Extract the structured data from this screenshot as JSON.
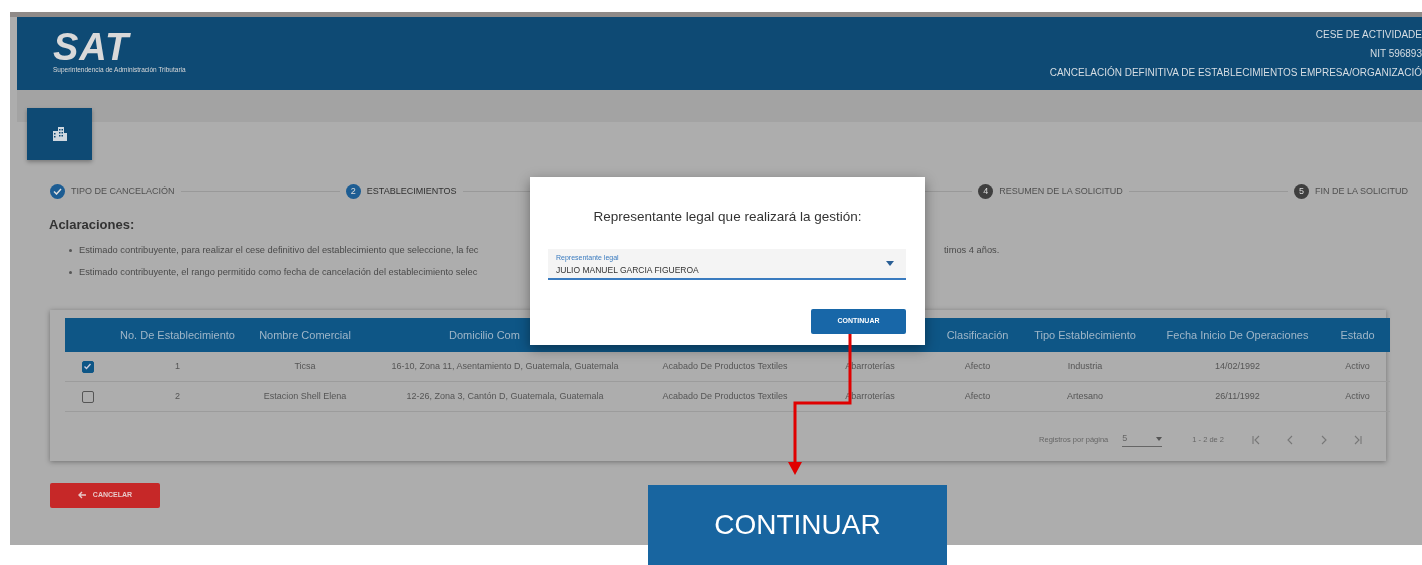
{
  "header": {
    "logo_text": "SAT",
    "logo_subtitle": "Superintendencia de Administración Tributaria",
    "lines": [
      "CESE DE ACTIVIDADE",
      "NIT 596893",
      "CANCELACIÓN DEFINITIVA DE ESTABLECIMIENTOS EMPRESA/ORGANIZACIÓ"
    ]
  },
  "stepper": [
    {
      "label": "TIPO DE CANCELACIÓN",
      "done": true,
      "active": false
    },
    {
      "number": "2",
      "label": "ESTABLECIMIENTOS",
      "done": false,
      "active": true
    },
    {
      "number": "4",
      "label": "RESUMEN DE LA SOLICITUD",
      "done": false,
      "active": false
    },
    {
      "number": "5",
      "label": "FIN DE LA SOLICITUD",
      "done": false,
      "active": false
    }
  ],
  "notes": {
    "title": "Aclaraciones:",
    "items": [
      {
        "text": "Estimado contribuyente, para realizar el cese definitivo del establecimiento que seleccione, la fec",
        "text_after": "timos 4 años."
      },
      {
        "text": "Estimado contribuyente, el rango permitido como fecha de cancelación del establecimiento selec"
      }
    ]
  },
  "table": {
    "columns": [
      {
        "label": "No. De Establecimiento"
      },
      {
        "label": "Nombre Comercial"
      },
      {
        "label": "Domicilio Com",
        "cut": true
      },
      {},
      {},
      {
        "label": "Clasificación"
      },
      {
        "label": "Tipo Establecimiento"
      },
      {
        "label": "Fecha Inicio De Operaciones"
      },
      {
        "label": "Estado"
      }
    ],
    "rows": [
      {
        "checked": true,
        "cells": [
          "1",
          "Ticsa",
          "16-10, Zona 11, Asentamiento D, Guatemala, Guatemala",
          "Acabado De Productos Textiles",
          "Abarroterías",
          "Afecto",
          "Industria",
          "14/02/1992",
          "Activo"
        ]
      },
      {
        "checked": false,
        "cells": [
          "2",
          "Estacion Shell Elena",
          "12-26, Zona 3, Cantón D, Guatemala, Guatemala",
          "Acabado De Productos Textiles",
          "Abarroterías",
          "Afecto",
          "Artesano",
          "26/11/1992",
          "Activo"
        ]
      }
    ],
    "paginator": {
      "label": "Registros por página",
      "page_size": "5",
      "range": "1 - 2 de 2"
    }
  },
  "cancel_button": "CANCELAR",
  "modal": {
    "title": "Representante legal que realizará la gestión:",
    "field": {
      "label": "Representante legal",
      "value": "JULIO MANUEL GARCIA FIGUEROA"
    },
    "button": "CONTINUAR"
  },
  "callout": {
    "label": "CONTINUAR"
  }
}
